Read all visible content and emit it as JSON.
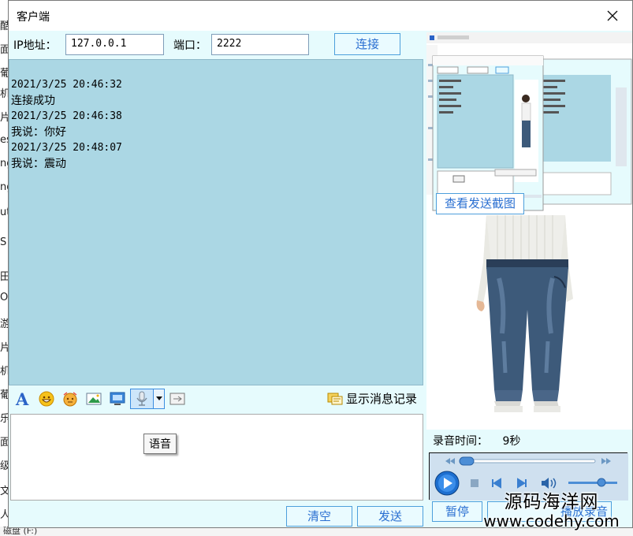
{
  "window": {
    "title": "客户端"
  },
  "connection": {
    "ip_label": "IP地址：",
    "ip_value": "127.0.0.1",
    "port_label": "端口：",
    "port_value": "2222",
    "connect_label": "连接"
  },
  "chat": {
    "messages": [
      {
        "time": "2021/3/25 20:46:32",
        "text": "连接成功"
      },
      {
        "time": "2021/3/25 20:46:38",
        "text": "我说：你好"
      },
      {
        "time": "2021/3/25 20:48:07",
        "text": "我说：震动"
      }
    ]
  },
  "toolbar": {
    "icons": [
      "font-icon",
      "emoji-icon",
      "shake-icon",
      "image-icon",
      "screenshot-icon",
      "microphone-icon",
      "dropdown-arrow-icon",
      "screen-share-icon"
    ],
    "history_label": "显示消息记录"
  },
  "input": {
    "tooltip": "语音"
  },
  "buttons": {
    "clear": "清空",
    "send": "发送"
  },
  "right": {
    "view_screenshot_label": "查看发送截图",
    "record_time_label": "录音时间：",
    "record_time_value": "9秒",
    "pause_label": "暂停",
    "play_label": "播放录音"
  },
  "watermark": {
    "line1": "源码海洋网",
    "line2": "www.codehy.com"
  },
  "background": {
    "left_fragments": [
      "酷",
      "面",
      "葡",
      "机",
      "片",
      "es",
      "ng",
      "ng",
      "ut",
      "S",
      "田",
      "O",
      "游",
      "片",
      "机",
      "葡",
      "乐",
      "面",
      "级",
      "文件",
      "人"
    ],
    "bottom_text": "磁盘 (F:)"
  },
  "colors": {
    "chat_bg": "#abd7e4",
    "panel_bg": "#e6fbfd",
    "button_text": "#2a6fd1"
  }
}
